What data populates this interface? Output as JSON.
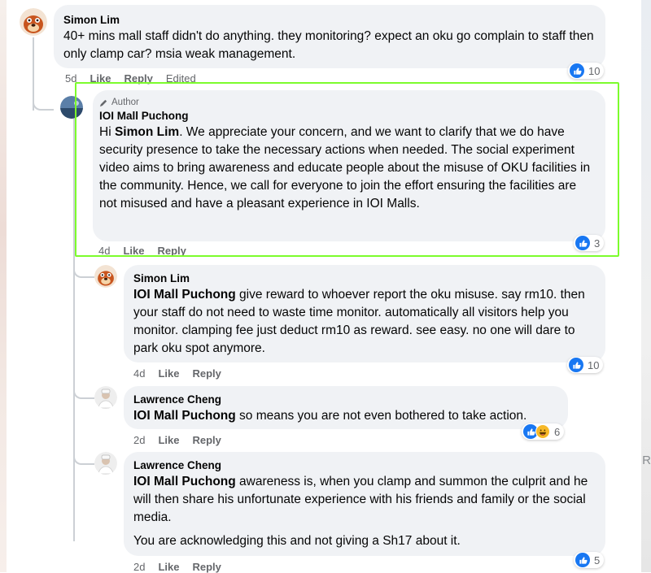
{
  "colors": {
    "bubble_bg": "#f0f2f5",
    "like_blue": "#1877f2",
    "highlight": "#7cfc2c",
    "meta_gray": "#65676b"
  },
  "side_letter": "R",
  "comments": [
    {
      "author": "Simon Lim",
      "text": "40+ mins mall staff didn't do anything. they monitoring? expect an oku go complain to staff then only clamp car? msia weak management.",
      "time": "5d",
      "like": "Like",
      "reply": "Reply",
      "edited": "Edited",
      "reactions": "10"
    },
    {
      "badge": "Author",
      "author": "IOI Mall Puchong",
      "greeting": "Hi",
      "mention": "Simon Lim",
      "text": ". We appreciate your concern, and we want to clarify that we do have security presence to take the necessary actions when needed. The social experiment video aims to bring awareness and educate people about the misuse of OKU facilities in the community. Hence, we call for everyone to join the effort ensuring the facilities are not misused and have a pleasant experience in IOI Malls.",
      "time": "4d",
      "like": "Like",
      "reply": "Reply",
      "reactions": "3"
    },
    {
      "author": "Simon Lim",
      "mention": "IOI Mall Puchong",
      "text": " give reward to whoever report the oku misuse. say rm10. then your staff do not need to waste time monitor. automatically all visitors help you monitor. clamping fee just deduct rm10 as reward. see easy. no one will dare to park oku spot anymore.",
      "time": "4d",
      "like": "Like",
      "reply": "Reply",
      "reactions": "10"
    },
    {
      "author": "Lawrence Cheng",
      "mention": "IOI Mall Puchong",
      "text": " so means you are not even bothered to take action.",
      "time": "2d",
      "like": "Like",
      "reply": "Reply",
      "reactions": "6"
    },
    {
      "author": "Lawrence Cheng",
      "mention": "IOI Mall Puchong",
      "text": " awareness is, when you clamp and summon the culprit and he will then share his unfortunate experience with his friends and family or the social media.",
      "text2": "You are acknowledging this and not giving a Sh17 about it.",
      "time": "2d",
      "like": "Like",
      "reply": "Reply",
      "reactions": "5"
    }
  ]
}
